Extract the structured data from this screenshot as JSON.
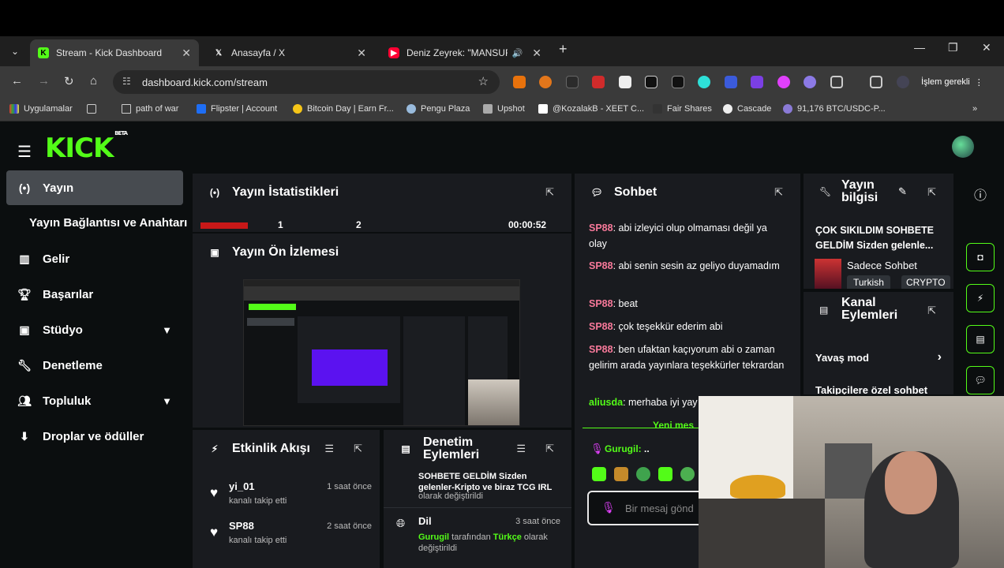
{
  "browser": {
    "tabs": [
      {
        "title": "Stream - Kick Dashboard",
        "active": true,
        "favicon": "kick-icon"
      },
      {
        "title": "Anasayfa / X",
        "active": false,
        "favicon": "x-icon"
      },
      {
        "title": "Deniz Zeyrek: \"MANSUR YA",
        "active": false,
        "favicon": "youtube-icon"
      }
    ],
    "url": "dashboard.kick.com/stream",
    "profile_label": "İşlem gerekli",
    "bookmarks": [
      "Uygulamalar",
      "path of war",
      "Flipster | Account",
      "Bitcoin Day | Earn Fr...",
      "Pengu Plaza",
      "Upshot",
      "@KozalakB - XEET C...",
      "Fair Shares",
      "Cascade",
      "91,176 BTC/USDC-P..."
    ]
  },
  "app": {
    "logo": "KICK",
    "logo_badge": "BETA",
    "sidebar": [
      {
        "label": "Yayın",
        "icon": "broadcast-icon",
        "active": true
      },
      {
        "label": "Yayın Bağlantısı ve Anahtarı",
        "sub": true
      },
      {
        "label": "Gelir",
        "icon": "chart-icon"
      },
      {
        "label": "Başarılar",
        "icon": "trophy-icon"
      },
      {
        "label": "Stüdyo",
        "icon": "studio-icon",
        "expandable": true
      },
      {
        "label": "Denetleme",
        "icon": "wrench-icon"
      },
      {
        "label": "Topluluk",
        "icon": "community-icon",
        "expandable": true
      },
      {
        "label": "Droplar ve ödüller",
        "icon": "drops-icon"
      }
    ],
    "stats": {
      "title": "Yayın İstatistikleri",
      "values": [
        "1",
        "2",
        "00:00:52"
      ]
    },
    "preview": {
      "title": "Yayın Ön İzlemesi"
    },
    "activity": {
      "title": "Etkinlik Akışı",
      "items": [
        {
          "name": "yi_01",
          "sub": "kanalı takip etti",
          "time": "1 saat önce"
        },
        {
          "name": "SP88",
          "sub": "kanalı takip etti",
          "time": "2 saat önce"
        }
      ]
    },
    "moderation": {
      "title": "Denetim Eylemleri",
      "cut_text": "SOHBETE GELDİM Sizden gelenler-Kripto ve biraz TCG IRL",
      "cut_sub": "olarak değiştirildi",
      "item_title": "Dil",
      "item_time": "3 saat önce",
      "item_user": "Gurugil",
      "item_mid": "tarafından",
      "item_value": "Türkçe",
      "item_end": "olarak değiştirildi"
    },
    "chat": {
      "title": "Sohbet",
      "messages": [
        {
          "user": "SP88",
          "text": ": abi izleyici olup olmaması değil ya olay"
        },
        {
          "user": "SP88",
          "text": ": abi senin sesin az geliyo duyamadım"
        },
        {
          "user": "SP88",
          "text": ": beat"
        },
        {
          "user": "SP88",
          "text": ": çok teşekkür ederim abi"
        },
        {
          "user": "SP88",
          "text": ": ben ufaktan kaçıyorum abi o zaman gelirim arada yayınlara teşekkürler tekrardan"
        },
        {
          "user": "aliusda",
          "text": ": merhaba iyi yay"
        }
      ],
      "new_messages": "Yeni mes",
      "pinned_user": "Gurugil:",
      "pinned_text": "..",
      "input_placeholder": "Bir mesaj gönd"
    },
    "stream_info": {
      "title": "Yayın bilgisi",
      "stream_title": "ÇOK SIKILDIM SOHBETE GELDİM Sizden gelenle...",
      "category": "Sadece Sohbet",
      "tags": [
        "Turkish",
        "CRYPTO"
      ]
    },
    "channel_actions": {
      "title": "Kanal Eylemleri",
      "items": [
        "Yavaş mod",
        "Takipçilere özel sohbet"
      ]
    }
  },
  "colors": {
    "accent": "#53fc18",
    "username": "#f8799a",
    "panel": "#191b1f",
    "bg": "#0b0e0f"
  }
}
